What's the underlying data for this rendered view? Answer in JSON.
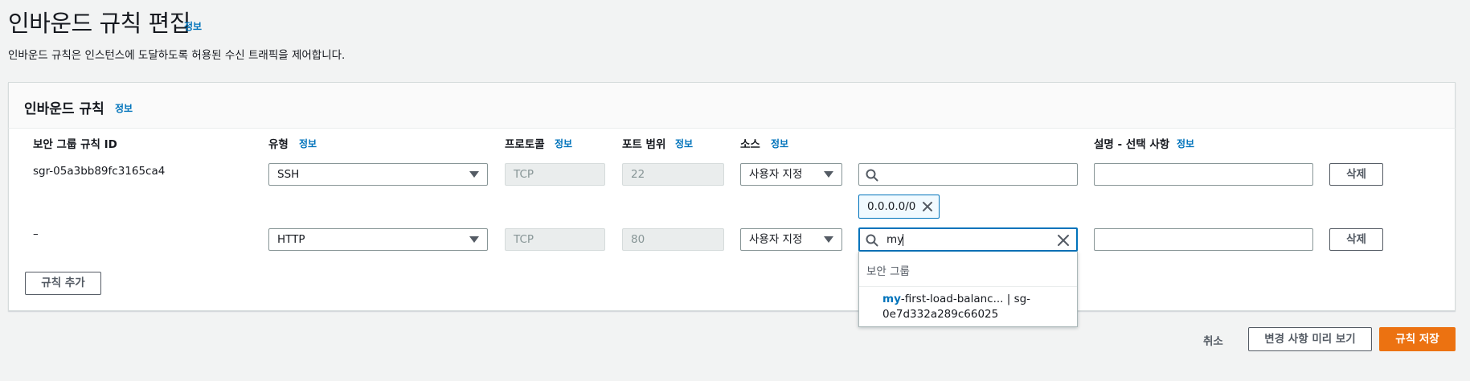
{
  "page": {
    "title": "인바운드 규칙 편집",
    "title_info": "정보",
    "description": "인바운드 규칙은 인스턴스에 도달하도록 허용된 수신 트래픽을 제어합니다."
  },
  "panel": {
    "title": "인바운드 규칙",
    "info": "정보",
    "columns": {
      "rule_id": "보안 그룹 규칙 ID",
      "type": "유형",
      "type_info": "정보",
      "protocol": "프로토콜",
      "protocol_info": "정보",
      "port": "포트 범위",
      "port_info": "정보",
      "source": "소스",
      "source_info": "정보",
      "description": "설명 - 선택 사항",
      "description_info": "정보"
    },
    "rows": [
      {
        "rule_id": "sgr-05a3bb89fc3165ca4",
        "type": "SSH",
        "protocol": "TCP",
        "port": "22",
        "source_mode": "사용자 지정",
        "source_search": "",
        "token": "0.0.0.0/0",
        "description": "",
        "delete_label": "삭제"
      },
      {
        "rule_id": "–",
        "type": "HTTP",
        "protocol": "TCP",
        "port": "80",
        "source_mode": "사용자 지정",
        "source_search": "my",
        "description": "",
        "delete_label": "삭제"
      }
    ],
    "add_rule_label": "규칙 추가"
  },
  "dropdown": {
    "group_label": "보안 그룹",
    "option_match": "my",
    "option_rest": "-first-load-balanc... | sg-0e7d332a289c66025"
  },
  "footer": {
    "cancel_label": "취소",
    "preview_label": "변경 사항 미리 보기",
    "save_label": "규칙 저장"
  },
  "colors": {
    "accent": "#0073bb",
    "primary_button": "#ec7211",
    "background": "#f2f3f3"
  },
  "icons": [
    "search-icon",
    "close-icon",
    "caret-down-icon"
  ]
}
